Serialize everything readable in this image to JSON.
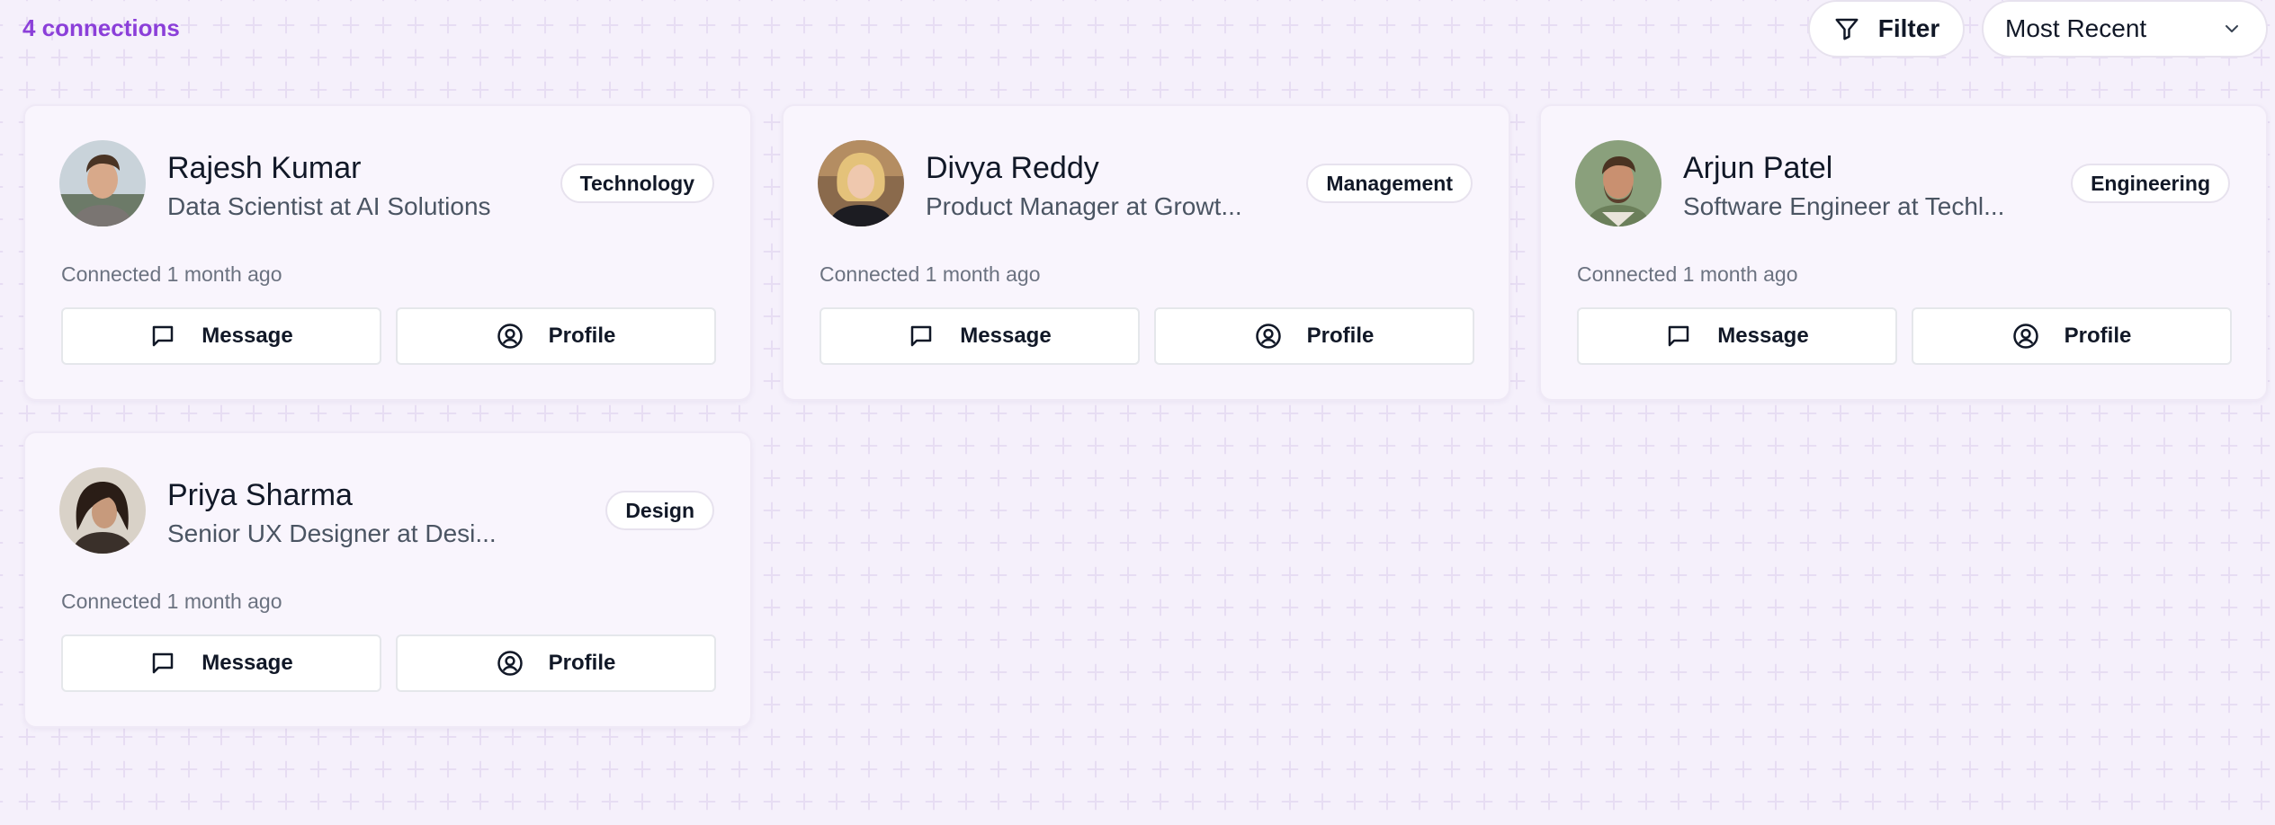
{
  "header": {
    "connection_count": "4 connections",
    "filter_label": "Filter",
    "sort_value": "Most Recent"
  },
  "connections": [
    {
      "name": "Rajesh Kumar",
      "title": "Data Scientist at AI Solutions",
      "category": "Technology",
      "connected": "Connected 1 month ago",
      "message_label": "Message",
      "profile_label": "Profile"
    },
    {
      "name": "Divya Reddy",
      "title": "Product Manager at Growt...",
      "category": "Management",
      "connected": "Connected 1 month ago",
      "message_label": "Message",
      "profile_label": "Profile"
    },
    {
      "name": "Arjun Patel",
      "title": "Software Engineer at Techl...",
      "category": "Engineering",
      "connected": "Connected 1 month ago",
      "message_label": "Message",
      "profile_label": "Profile"
    },
    {
      "name": "Priya Sharma",
      "title": "Senior UX Designer at Desi...",
      "category": "Design",
      "connected": "Connected 1 month ago",
      "message_label": "Message",
      "profile_label": "Profile"
    }
  ],
  "icons": {
    "filter": "filter-icon",
    "sort": "chevron-down-icon",
    "message": "message-square-icon",
    "profile": "user-circle-icon"
  },
  "colors": {
    "accent": "#8b3fd9",
    "background": "#f5f0fb",
    "card": "#f9f5fd"
  }
}
